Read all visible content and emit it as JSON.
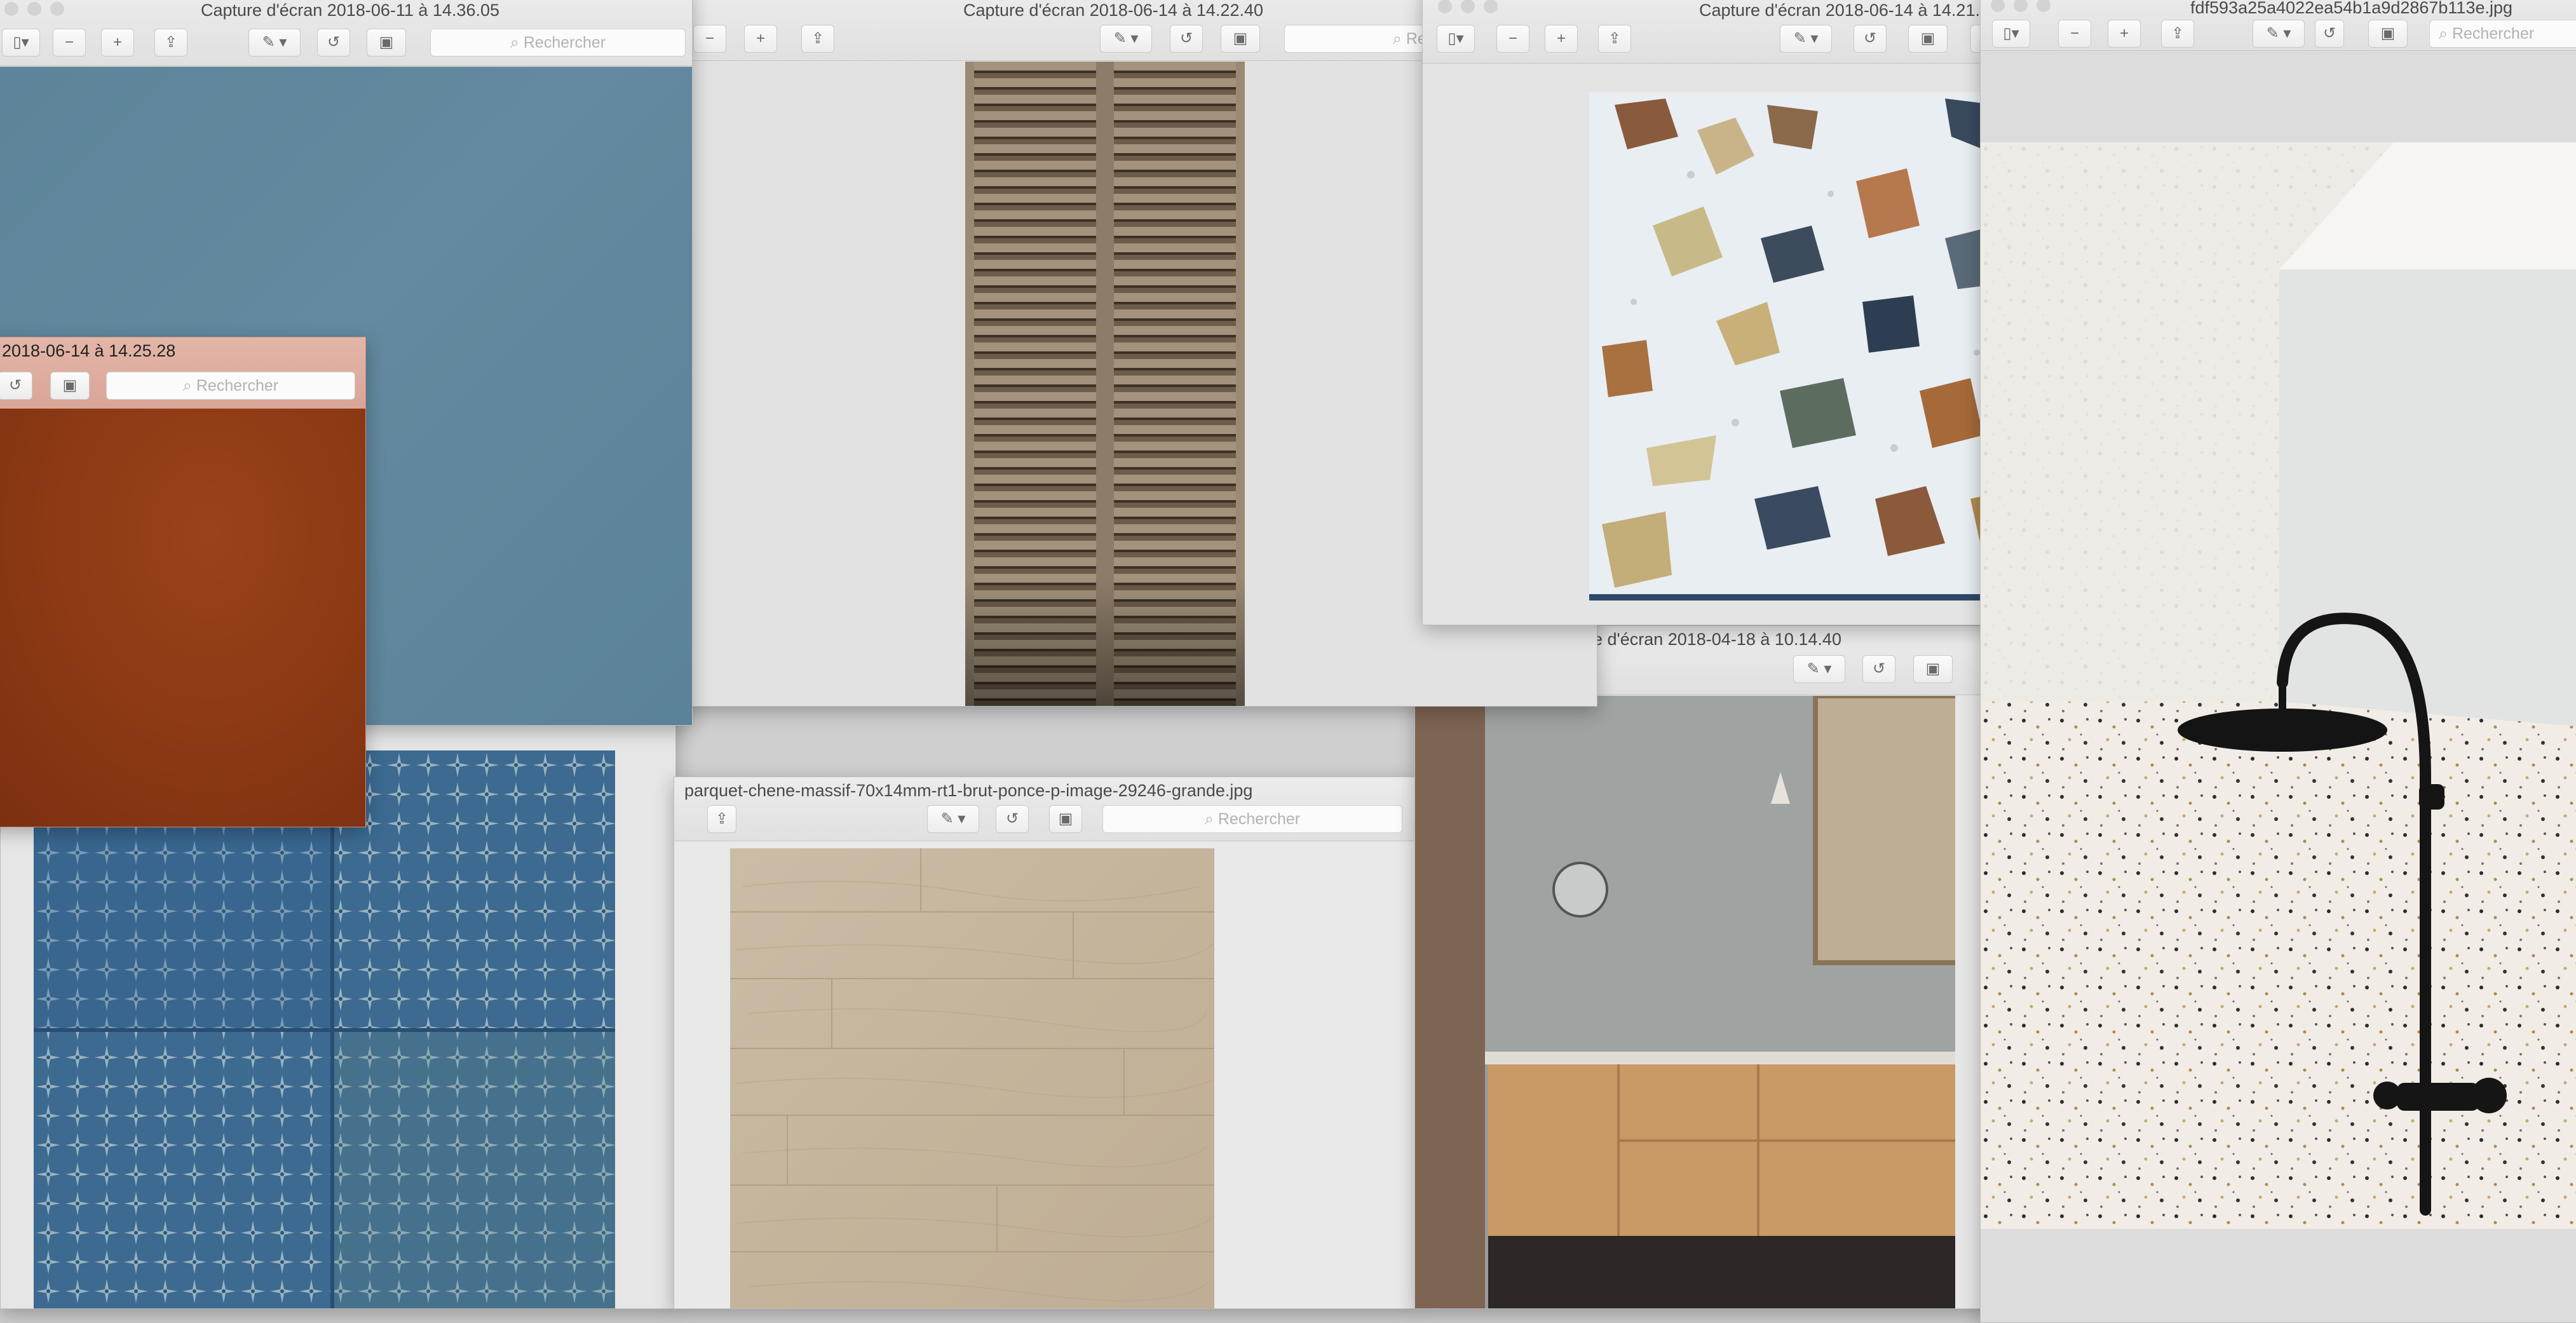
{
  "search_placeholder": "Rechercher",
  "windows": {
    "blue": {
      "title": "Capture d'écran 2018-06-11 à 14.36.05"
    },
    "shutters": {
      "title": "Capture d'écran 2018-06-14 à 14.22.40"
    },
    "terrazzo": {
      "title": "Capture d'écran 2018-06-14 à 14.21."
    },
    "shower": {
      "title": "fdf593a25a4022ea54b1a9d2867b113e.jpg"
    },
    "leather": {
      "title": "2018-06-14 à 14.25.28"
    },
    "bathroom": {
      "title": "e d'écran 2018-04-18 à 10.14.40"
    },
    "parquet": {
      "title": "parquet-chene-massif-70x14mm-rt1-brut-ponce-p-image-29246-grande.jpg"
    }
  },
  "colors": {
    "blue_paint": "#5f879f",
    "leather": "#8e3a15",
    "parquet": "#c8b8a2",
    "tiles": "#3c6a90"
  }
}
